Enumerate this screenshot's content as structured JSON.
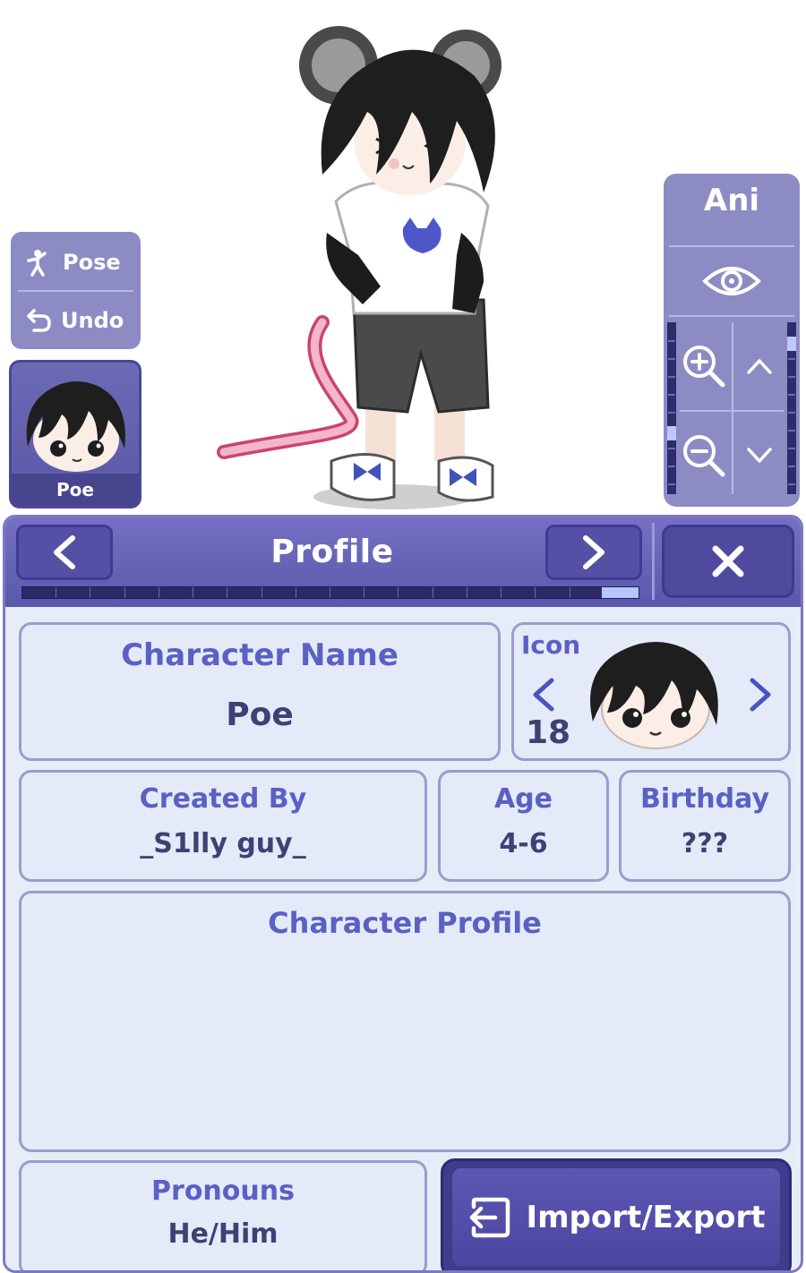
{
  "stage": {
    "pose_panel": {
      "pose_label": "Pose",
      "undo_label": "Undo"
    },
    "character_card": {
      "name": "Poe"
    },
    "ani_panel": {
      "label": "Ani"
    }
  },
  "panel": {
    "title": "Profile",
    "progress_fraction": 0.06,
    "fields": {
      "character_name": {
        "label": "Character Name",
        "value": "Poe"
      },
      "icon": {
        "label": "Icon",
        "value": "18"
      },
      "created_by": {
        "label": "Created By",
        "value": "_S1lly guy_"
      },
      "age": {
        "label": "Age",
        "value": "4-6"
      },
      "birthday": {
        "label": "Birthday",
        "value": "???"
      },
      "character_profile": {
        "label": "Character Profile",
        "value": ""
      },
      "pronouns": {
        "label": "Pronouns",
        "value": "He/Him"
      }
    },
    "import_export_label": "Import/Export"
  },
  "icons": [
    "pose-icon",
    "undo-icon",
    "eye-icon",
    "zoom-in-icon",
    "zoom-out-icon",
    "chevron-up-icon",
    "chevron-down-icon",
    "chevron-left-icon",
    "chevron-right-icon",
    "close-icon",
    "import-export-icon"
  ],
  "colors": {
    "accent": "#5a58ab",
    "panel_bg": "#e7ecf9",
    "side_panel": "#8d8bc4",
    "label_text": "#5a60c4",
    "value_text": "#3c4273"
  }
}
